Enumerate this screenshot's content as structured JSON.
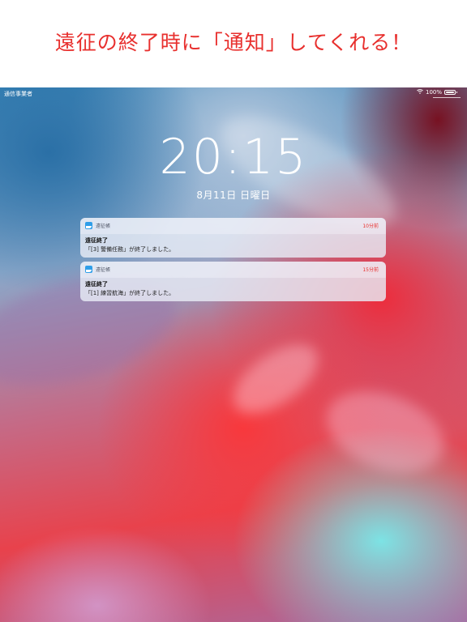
{
  "headline": "遠征の終了時に「通知」してくれる！",
  "statusbar": {
    "carrier": "通信事業者",
    "battery_text": "100%",
    "wifi_icon": "wifi-icon",
    "battery_icon": "battery-icon"
  },
  "lockscreen": {
    "time": "20:15",
    "date": "8月11日 日曜日"
  },
  "notifications": [
    {
      "app_name": "遠征帳",
      "time_ago": "10分前",
      "title": "遠征終了",
      "body": "「[3] 警備任務」が終了しました。"
    },
    {
      "app_name": "遠征帳",
      "time_ago": "15分前",
      "title": "遠征終了",
      "body": "「[1] 練習航海」が終了しました。"
    }
  ],
  "colors": {
    "headline": "#e8302e",
    "notification_time": "#e8302e",
    "app_icon": "#2f9ee8"
  }
}
